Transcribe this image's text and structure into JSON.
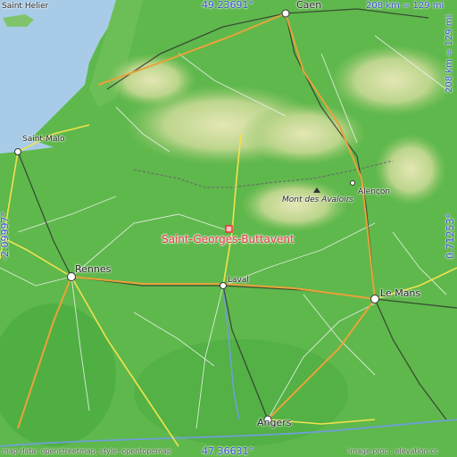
{
  "place": {
    "name": "Saint-Georges-Buttavent"
  },
  "coords": {
    "top_lat": "49.23691°",
    "bottom_lat": "47.36631°",
    "left_lon": "-2.09997°",
    "right_lon": "0.71253°"
  },
  "scale": {
    "horizontal": "208 km = 129 mi",
    "vertical": "208 km = 129 mi"
  },
  "labels": {
    "saint_helier": "Saint Helier",
    "caen": "Caen",
    "saint_malo": "Saint-Malo",
    "mont_des_avaloirs": "Mont des Avaloirs",
    "alencon": "Alençon",
    "rennes": "Rennes",
    "laval": "Laval",
    "le_mans": "Le Mans",
    "angers": "Angers"
  },
  "attribution": {
    "left": "map data: openstreetmap, style: opentopomap",
    "right": "image proc.: elevation.cc"
  },
  "colors": {
    "sea": "#a8cce8",
    "lowland": "#58b548",
    "upland": "#c9dc9a",
    "marker": "#e8343f",
    "coord_text": "#3a4fd8"
  }
}
